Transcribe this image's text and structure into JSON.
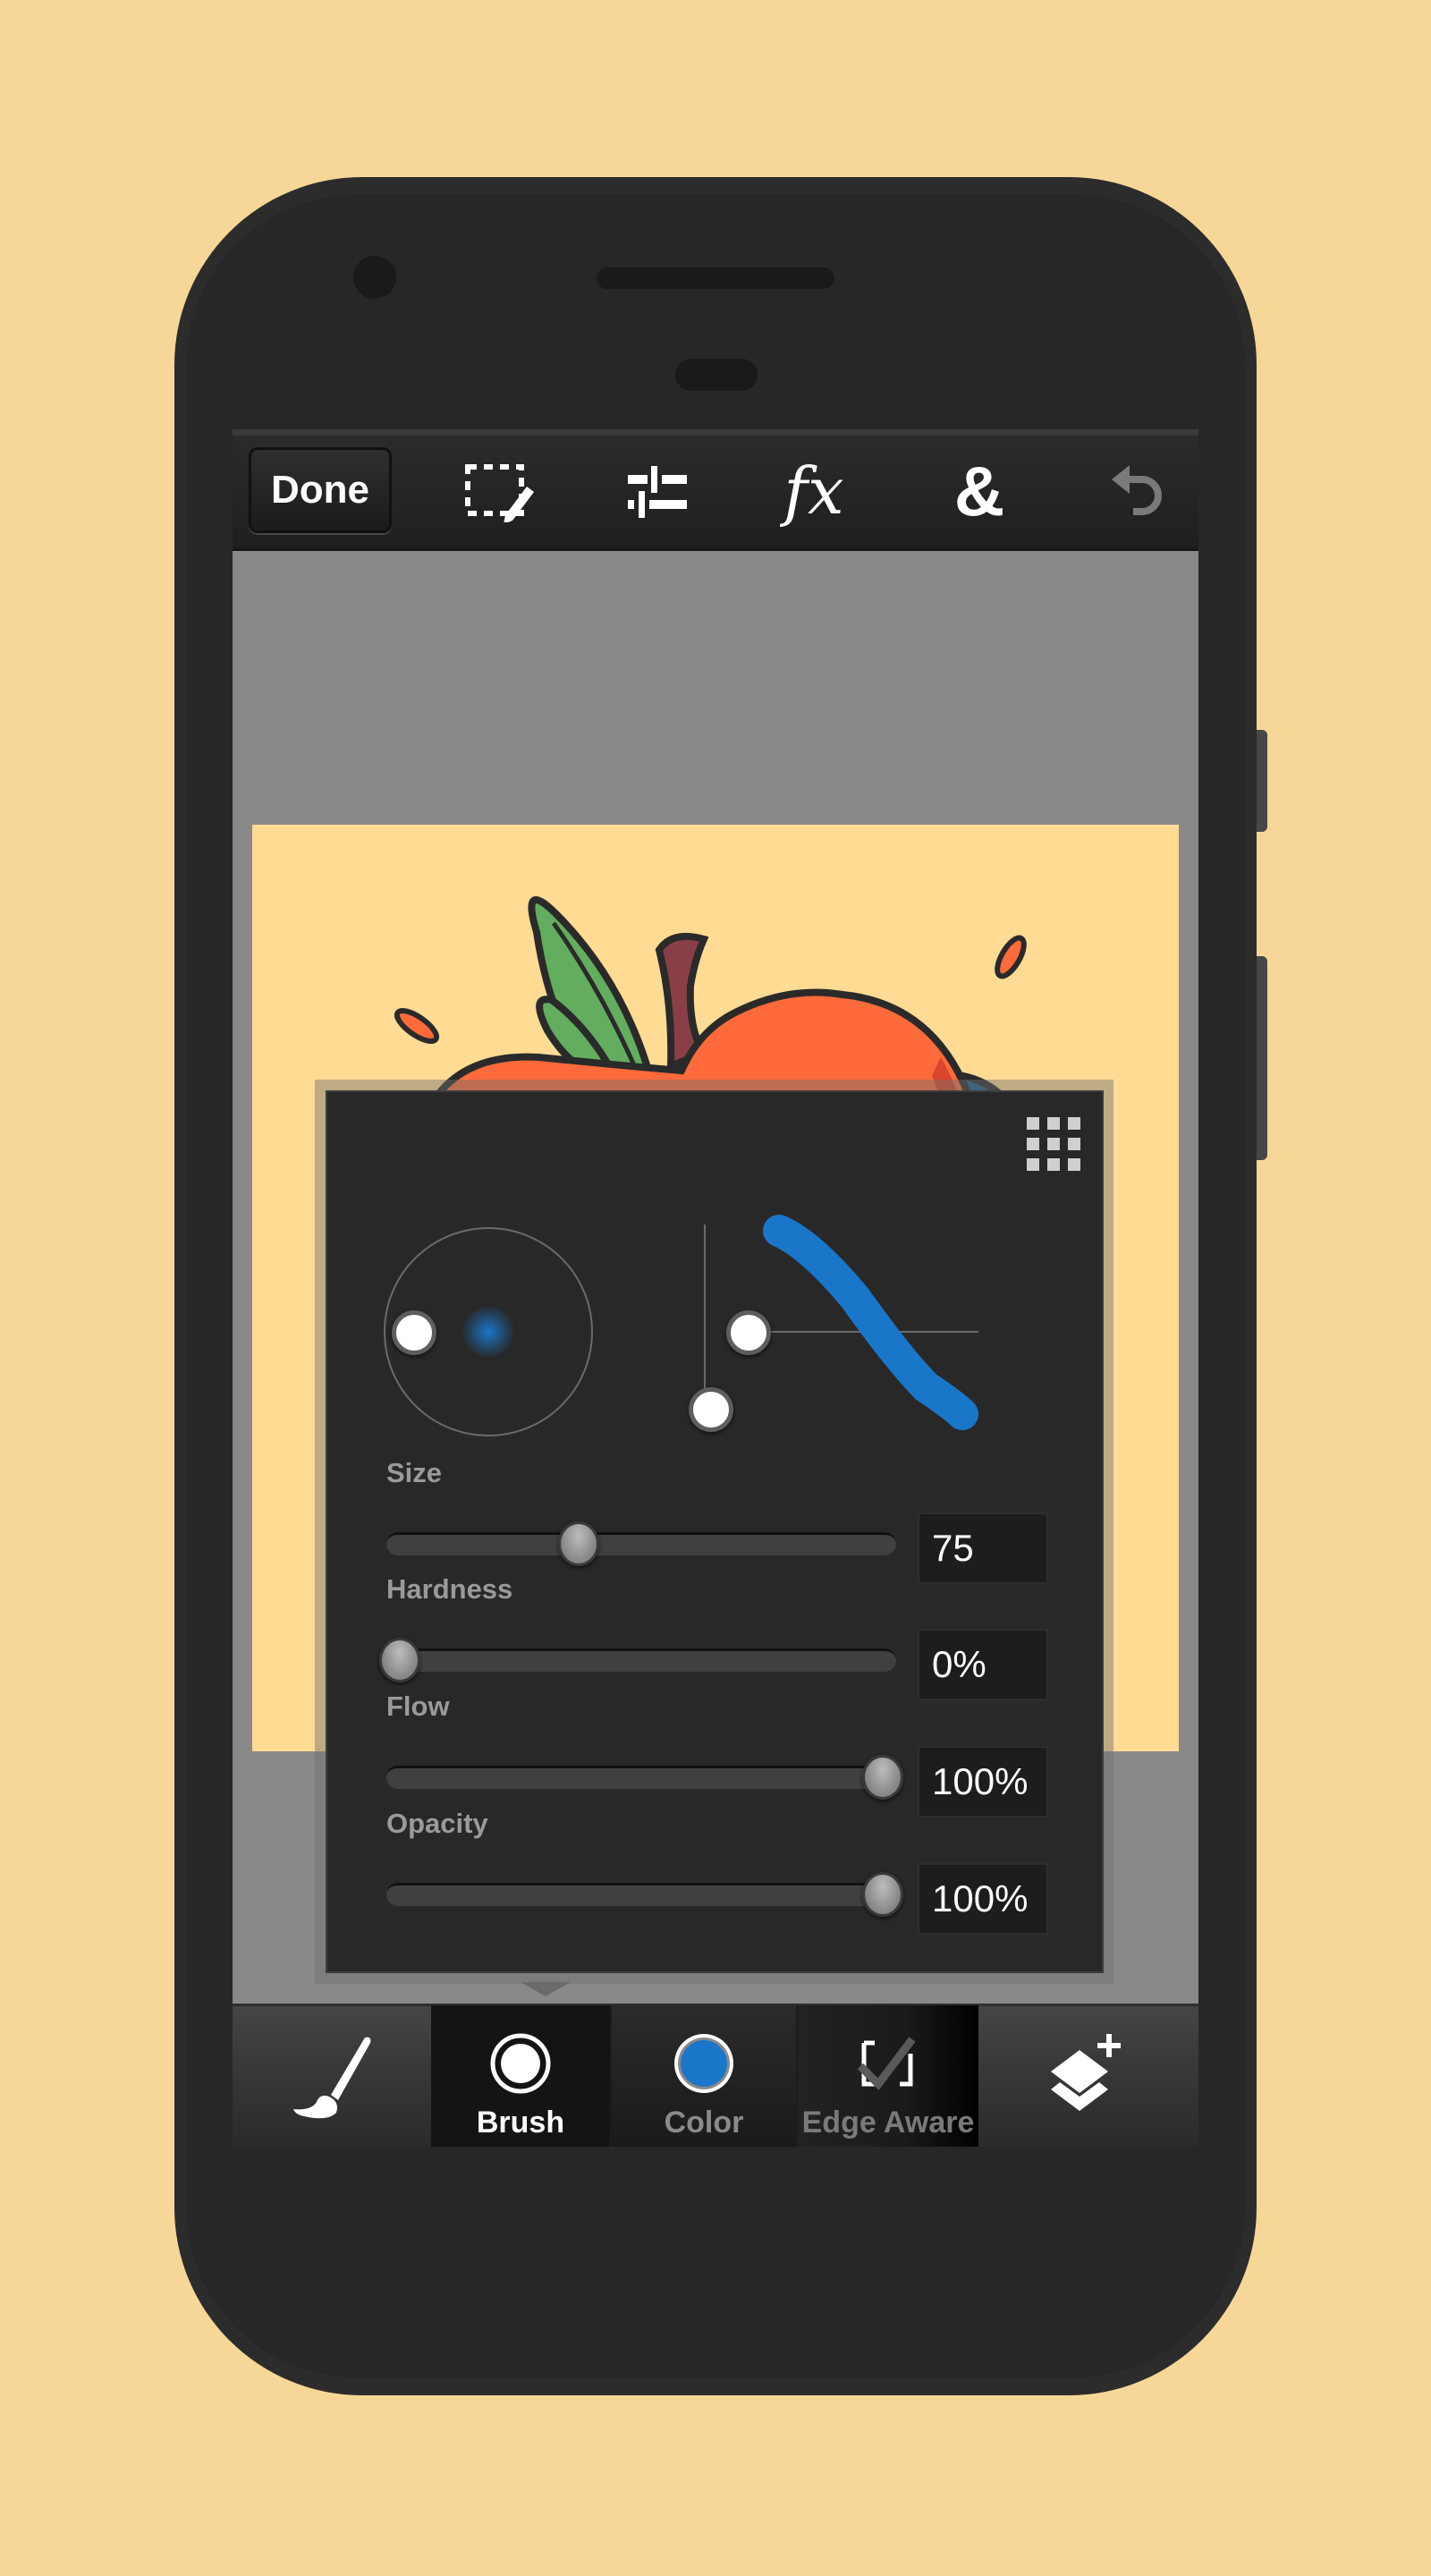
{
  "toolbar": {
    "done_label": "Done",
    "icons": [
      "selection-edit-icon",
      "adjustments-icon",
      "fx-icon",
      "blend-icon",
      "undo-icon"
    ],
    "fx_label": "fx",
    "blend_label": "&"
  },
  "brush_settings": {
    "grid_icon": "grid-icon",
    "sliders": [
      {
        "label": "Size",
        "value": "75",
        "fraction": 0.37
      },
      {
        "label": "Hardness",
        "value": "0%",
        "fraction": 0.0
      },
      {
        "label": "Flow",
        "value": "100%",
        "fraction": 1.0
      },
      {
        "label": "Opacity",
        "value": "100%",
        "fraction": 1.0
      }
    ],
    "preview_color": "#1a76c9"
  },
  "bottom_bar": {
    "left_icon": "paintbrush-icon",
    "tabs": [
      {
        "label": "Brush",
        "icon": "brush-circle-icon",
        "active": true
      },
      {
        "label": "Color",
        "icon": "color-swatch-icon",
        "active": false
      },
      {
        "label": "Edge Aware",
        "icon": "checkbox-icon",
        "active": false
      }
    ],
    "right_icon": "add-layer-icon"
  },
  "colors": {
    "background": "#f7d797",
    "canvas": "#ffdb94",
    "apple": "#ff6a3b",
    "leaf": "#63ad5f",
    "stem": "#8a3f47",
    "brush_blue": "#1a76c9"
  }
}
